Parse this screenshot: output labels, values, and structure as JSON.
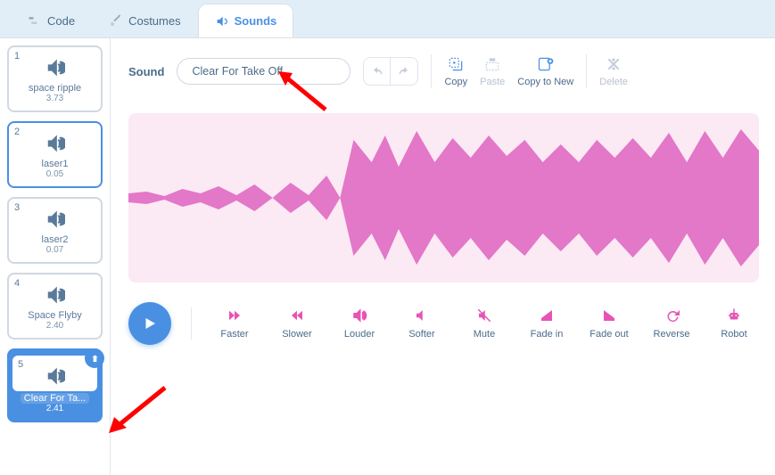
{
  "tabs": {
    "code": "Code",
    "costumes": "Costumes",
    "sounds": "Sounds"
  },
  "sound_list": [
    {
      "num": "1",
      "name": "space ripple",
      "duration": "3.73",
      "state": "normal"
    },
    {
      "num": "2",
      "name": "laser1",
      "duration": "0.05",
      "state": "highlight"
    },
    {
      "num": "3",
      "name": "laser2",
      "duration": "0.07",
      "state": "normal"
    },
    {
      "num": "4",
      "name": "Space Flyby",
      "duration": "2.40",
      "state": "normal"
    },
    {
      "num": "5",
      "name": "Clear For Ta...",
      "duration": "2.41",
      "state": "selected"
    }
  ],
  "editor": {
    "sound_label": "Sound",
    "sound_name": "Clear For Take Off",
    "toolbar": {
      "copy": "Copy",
      "paste": "Paste",
      "copy_to_new": "Copy to New",
      "delete": "Delete"
    },
    "effects": {
      "faster": "Faster",
      "slower": "Slower",
      "louder": "Louder",
      "softer": "Softer",
      "mute": "Mute",
      "fade_in": "Fade in",
      "fade_out": "Fade out",
      "reverse": "Reverse",
      "robot": "Robot"
    }
  },
  "colors": {
    "accent_blue": "#4a90e2",
    "accent_pink": "#e754b5",
    "waveform_bg": "#fbe9f4",
    "waveform_fill": "#e377c8"
  }
}
